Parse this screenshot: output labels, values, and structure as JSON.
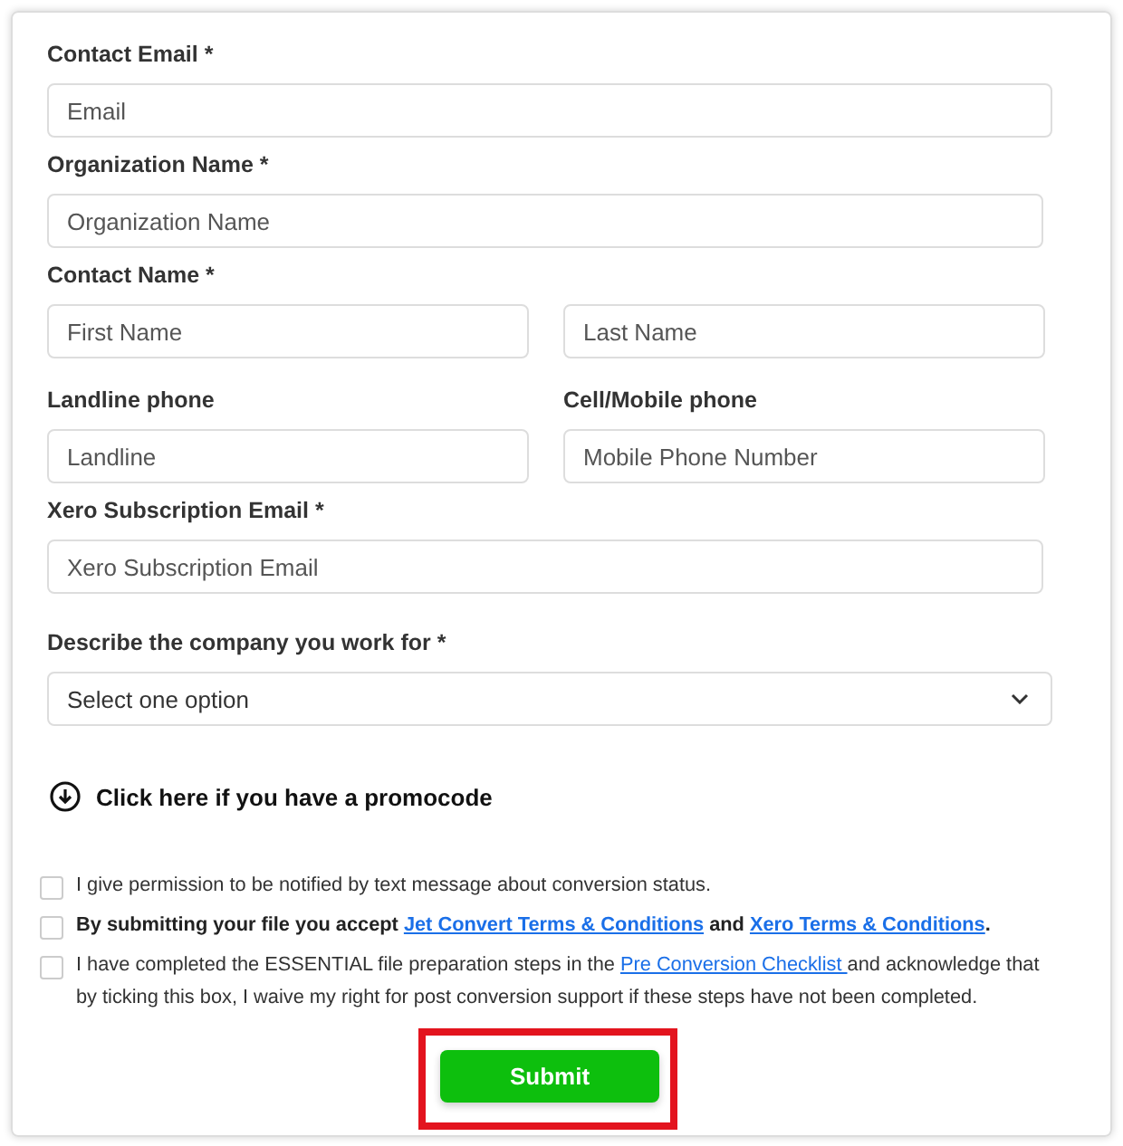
{
  "form": {
    "rows": [
      {
        "kind": "single",
        "label": "Contact Email *",
        "placeholder": "Email"
      },
      {
        "kind": "single",
        "label": "Organization Name *",
        "placeholder": "Organization Name"
      },
      {
        "kind": "pair",
        "label": "Contact Name *",
        "placeholders": [
          "First Name",
          "Last Name"
        ]
      },
      {
        "kind": "split",
        "columns": [
          {
            "label": "Landline phone",
            "placeholder": "Landline"
          },
          {
            "label": "Cell/Mobile phone",
            "placeholder": "Mobile Phone Number"
          }
        ]
      },
      {
        "kind": "single",
        "label": "Xero Subscription Email *",
        "placeholder": "Xero Subscription Email"
      },
      {
        "kind": "select",
        "label": "Describe the company you work for *",
        "value": "Select one option"
      }
    ],
    "promo": {
      "label": "Click here if you have a promocode",
      "expanded": false
    },
    "consents": [
      {
        "checked": false,
        "bold": false,
        "parts": [
          {
            "kind": "text",
            "text": "I give permission to be notified by text message about conversion status."
          }
        ]
      },
      {
        "checked": false,
        "bold": true,
        "parts": [
          {
            "kind": "text",
            "text": "By submitting your file you accept "
          },
          {
            "kind": "link",
            "text": "Jet Convert Terms & Conditions"
          },
          {
            "kind": "text",
            "text": " and "
          },
          {
            "kind": "link",
            "text": "Xero Terms & Conditions"
          },
          {
            "kind": "text",
            "text": "."
          }
        ]
      },
      {
        "checked": false,
        "bold": false,
        "parts": [
          {
            "kind": "text",
            "text": "I have completed the ESSENTIAL file preparation steps in the "
          },
          {
            "kind": "link",
            "text": "Pre Conversion Checklist "
          },
          {
            "kind": "text",
            "text": "and acknowledge that by ticking this box, I waive my right for post conversion support if these steps have not been completed."
          }
        ]
      }
    ],
    "submit": {
      "label": "Submit",
      "highlighted": true
    }
  }
}
